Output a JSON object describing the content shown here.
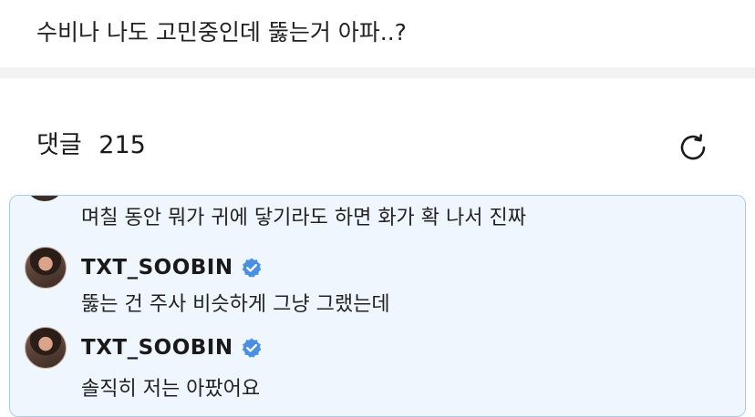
{
  "post": {
    "text": "수비나 나도 고민중인데 뚫는거 아파..?"
  },
  "comments": {
    "label": "댓글",
    "count": "215"
  },
  "thread": {
    "previous_reply": "며칠 동안 뭐가 귀에 닿기라도 하면 화가 확 나서 진짜",
    "replies": [
      {
        "username": "TXT_SOOBIN",
        "verified": true,
        "text": "뚫는 건 주사 비슷하게 그냥 그랬는데"
      },
      {
        "username": "TXT_SOOBIN",
        "verified": true,
        "text": "솔직히 저는 아팠어요"
      }
    ]
  },
  "colors": {
    "highlight_bg": "#eff6fd",
    "highlight_border": "#a9cdef",
    "verified_blue": "#4a90e2"
  },
  "icons": {
    "refresh": "refresh-icon",
    "verified": "verified-badge-icon"
  }
}
